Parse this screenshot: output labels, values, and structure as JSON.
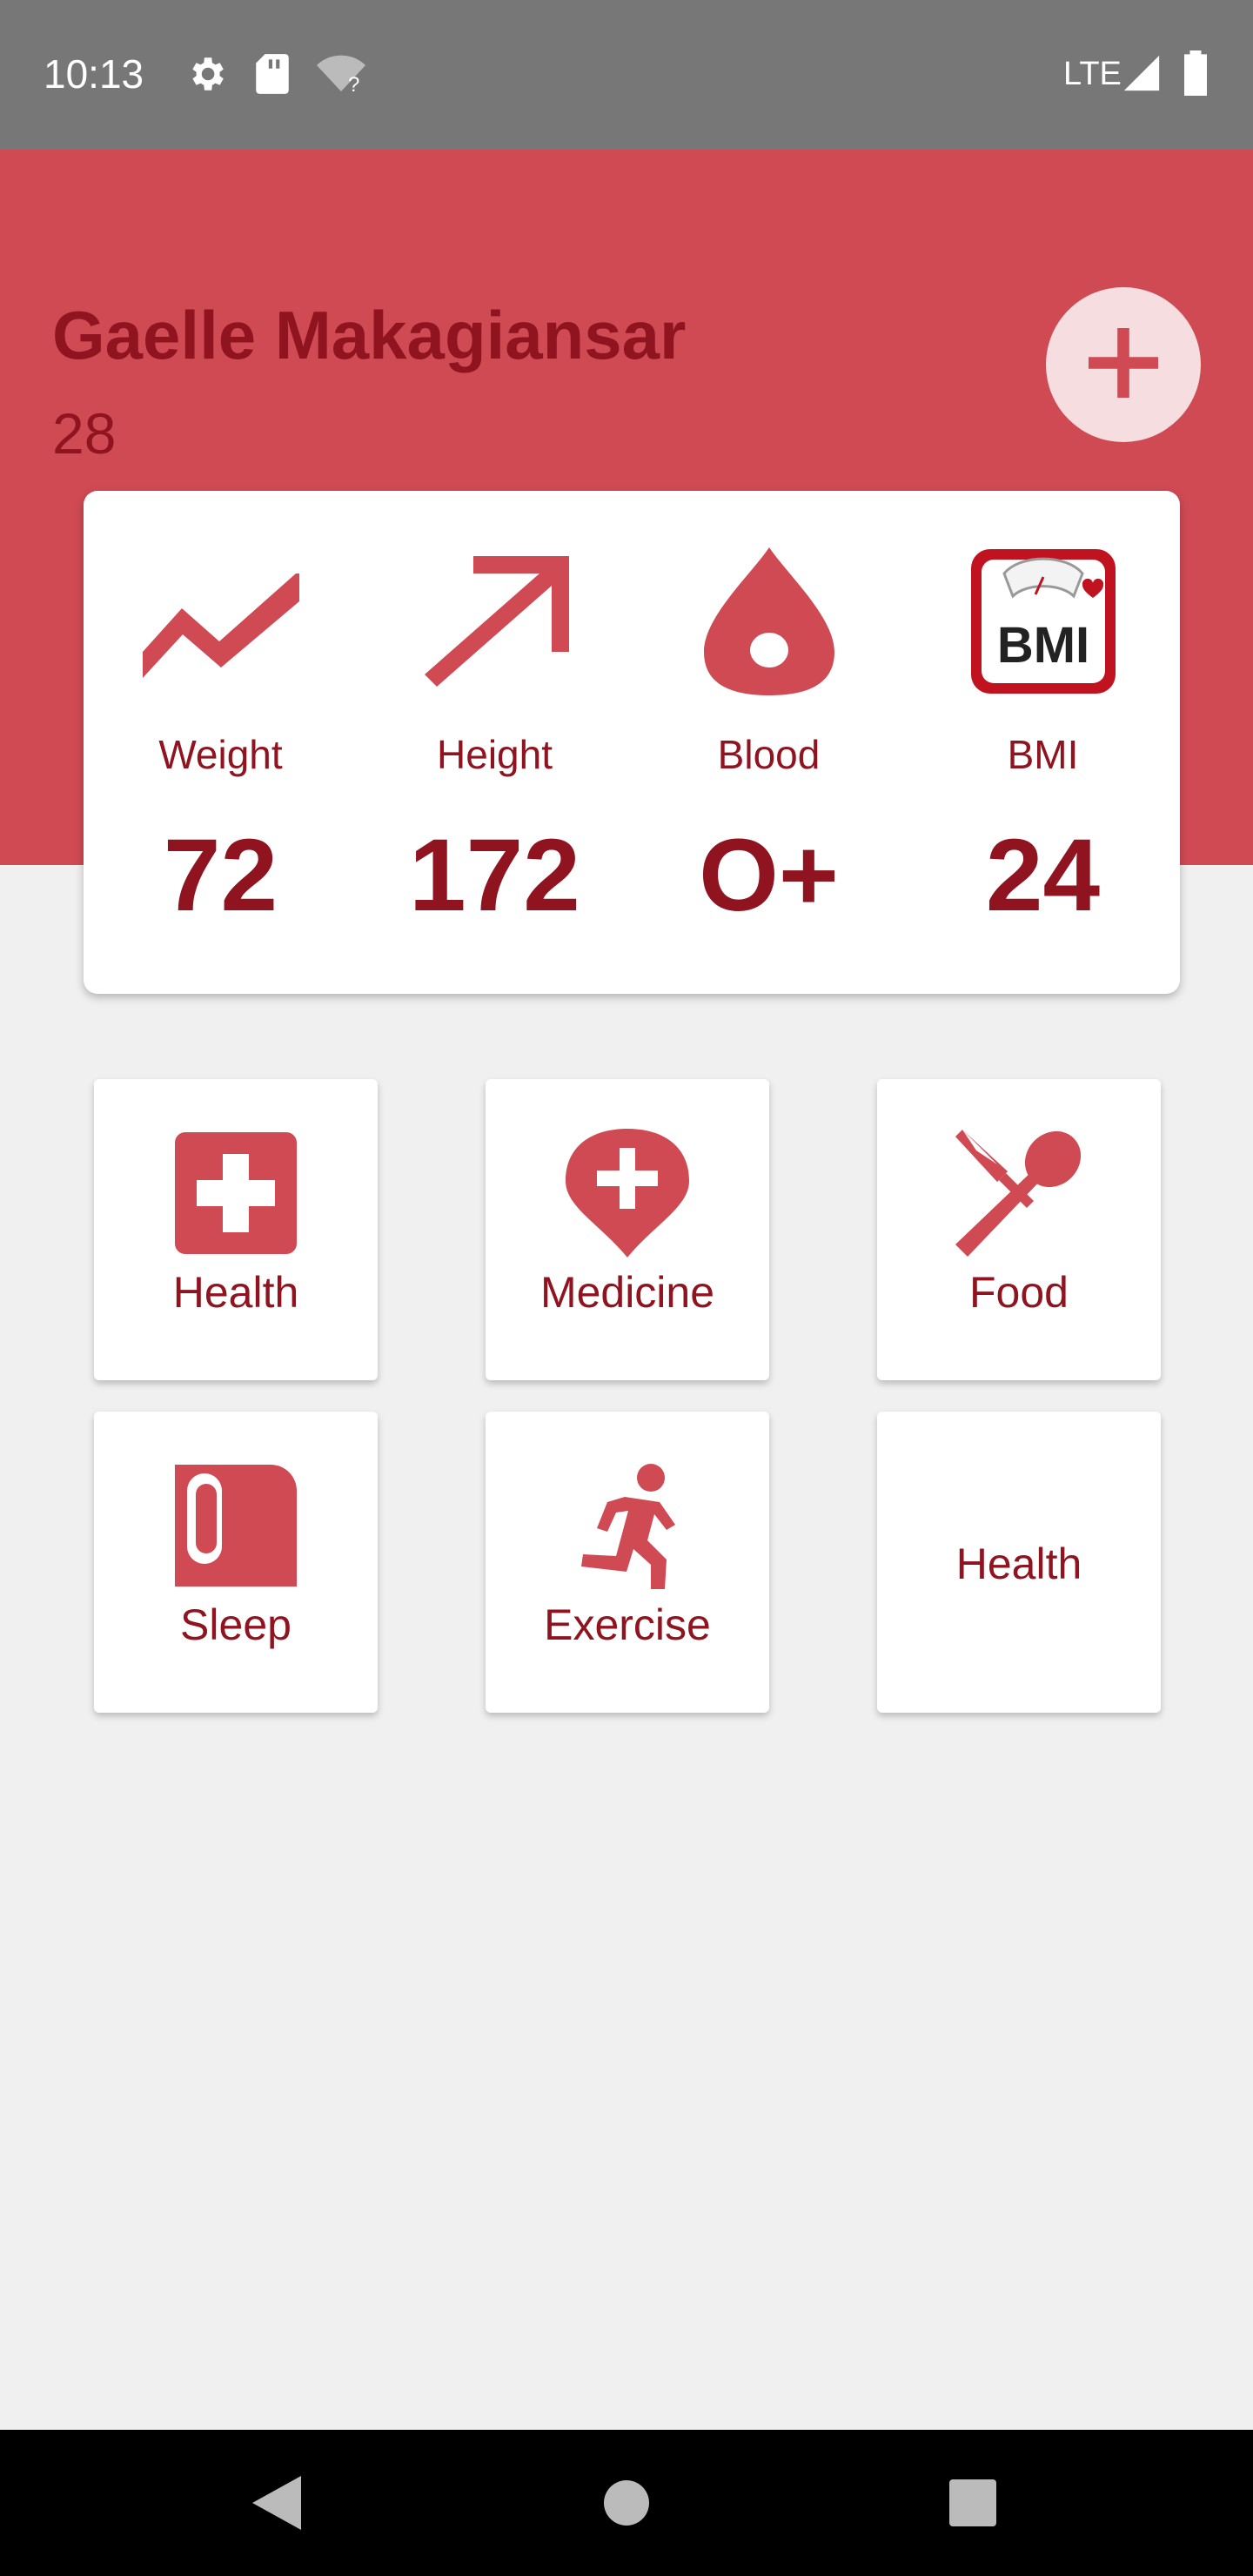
{
  "status_bar": {
    "time": "10:13",
    "network": "LTE",
    "icons": [
      "gear-icon",
      "sd-card-icon",
      "wifi-unknown-icon",
      "signal-icon",
      "battery-icon"
    ]
  },
  "profile": {
    "name": "Gaelle Makagiansar",
    "age": "28",
    "add_button_icon": "plus-icon"
  },
  "stats": [
    {
      "label": "Weight",
      "value": "72",
      "icon": "trend-line-icon"
    },
    {
      "label": "Height",
      "value": "172",
      "icon": "arrow-up-right-icon"
    },
    {
      "label": "Blood",
      "value": "O+",
      "icon": "blood-drop-icon"
    },
    {
      "label": "BMI",
      "value": "24",
      "icon": "bmi-scale-icon",
      "icon_text": "BMI"
    }
  ],
  "tiles": [
    {
      "label": "Health",
      "icon": "health-cross-icon"
    },
    {
      "label": "Medicine",
      "icon": "medicine-pin-icon"
    },
    {
      "label": "Food",
      "icon": "fork-spoon-icon"
    },
    {
      "label": "Sleep",
      "icon": "sleep-icon"
    },
    {
      "label": "Exercise",
      "icon": "running-icon"
    },
    {
      "label": "Health",
      "icon": ""
    }
  ],
  "nav": [
    "back-icon",
    "home-icon",
    "recents-icon"
  ],
  "colors": {
    "primary": "#d04a54",
    "dark_text": "#8f1420",
    "fab": "#f5dde0",
    "background": "#f0f0f0",
    "status_bar": "#777777"
  }
}
